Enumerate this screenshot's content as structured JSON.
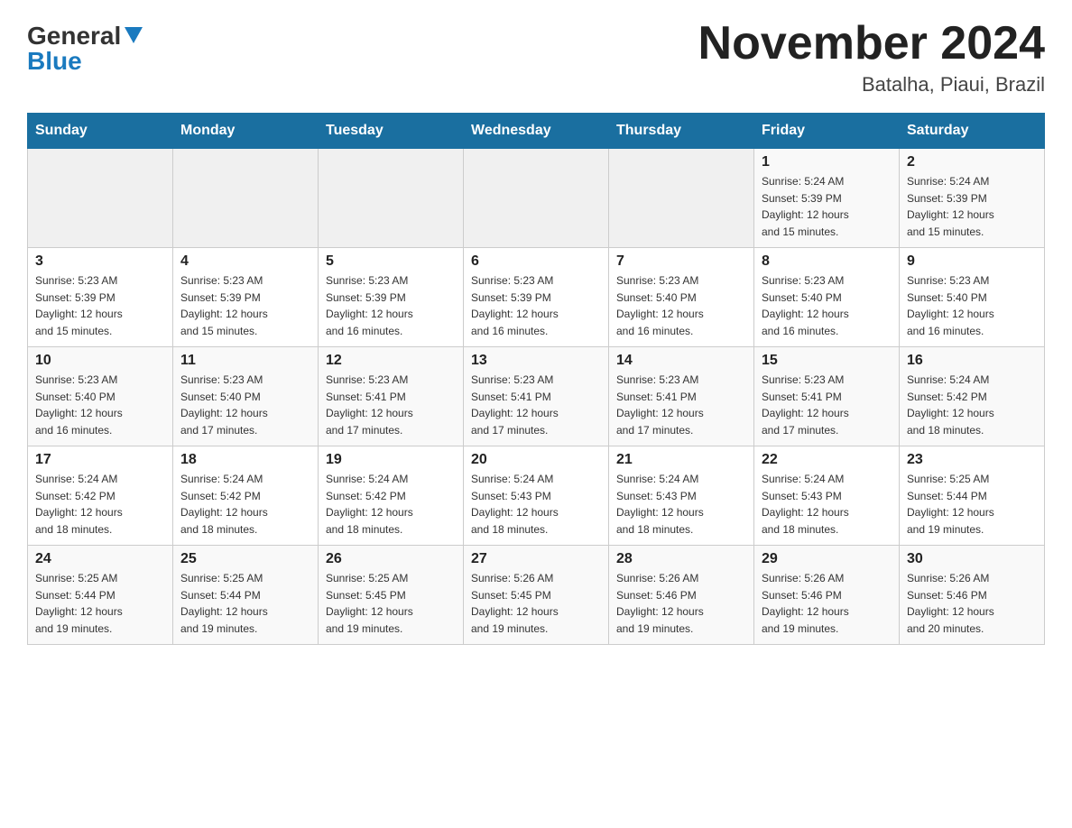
{
  "logo": {
    "general": "General",
    "blue": "Blue"
  },
  "title": "November 2024",
  "location": "Batalha, Piaui, Brazil",
  "days_of_week": [
    "Sunday",
    "Monday",
    "Tuesday",
    "Wednesday",
    "Thursday",
    "Friday",
    "Saturday"
  ],
  "weeks": [
    [
      {
        "day": "",
        "info": ""
      },
      {
        "day": "",
        "info": ""
      },
      {
        "day": "",
        "info": ""
      },
      {
        "day": "",
        "info": ""
      },
      {
        "day": "",
        "info": ""
      },
      {
        "day": "1",
        "info": "Sunrise: 5:24 AM\nSunset: 5:39 PM\nDaylight: 12 hours\nand 15 minutes."
      },
      {
        "day": "2",
        "info": "Sunrise: 5:24 AM\nSunset: 5:39 PM\nDaylight: 12 hours\nand 15 minutes."
      }
    ],
    [
      {
        "day": "3",
        "info": "Sunrise: 5:23 AM\nSunset: 5:39 PM\nDaylight: 12 hours\nand 15 minutes."
      },
      {
        "day": "4",
        "info": "Sunrise: 5:23 AM\nSunset: 5:39 PM\nDaylight: 12 hours\nand 15 minutes."
      },
      {
        "day": "5",
        "info": "Sunrise: 5:23 AM\nSunset: 5:39 PM\nDaylight: 12 hours\nand 16 minutes."
      },
      {
        "day": "6",
        "info": "Sunrise: 5:23 AM\nSunset: 5:39 PM\nDaylight: 12 hours\nand 16 minutes."
      },
      {
        "day": "7",
        "info": "Sunrise: 5:23 AM\nSunset: 5:40 PM\nDaylight: 12 hours\nand 16 minutes."
      },
      {
        "day": "8",
        "info": "Sunrise: 5:23 AM\nSunset: 5:40 PM\nDaylight: 12 hours\nand 16 minutes."
      },
      {
        "day": "9",
        "info": "Sunrise: 5:23 AM\nSunset: 5:40 PM\nDaylight: 12 hours\nand 16 minutes."
      }
    ],
    [
      {
        "day": "10",
        "info": "Sunrise: 5:23 AM\nSunset: 5:40 PM\nDaylight: 12 hours\nand 16 minutes."
      },
      {
        "day": "11",
        "info": "Sunrise: 5:23 AM\nSunset: 5:40 PM\nDaylight: 12 hours\nand 17 minutes."
      },
      {
        "day": "12",
        "info": "Sunrise: 5:23 AM\nSunset: 5:41 PM\nDaylight: 12 hours\nand 17 minutes."
      },
      {
        "day": "13",
        "info": "Sunrise: 5:23 AM\nSunset: 5:41 PM\nDaylight: 12 hours\nand 17 minutes."
      },
      {
        "day": "14",
        "info": "Sunrise: 5:23 AM\nSunset: 5:41 PM\nDaylight: 12 hours\nand 17 minutes."
      },
      {
        "day": "15",
        "info": "Sunrise: 5:23 AM\nSunset: 5:41 PM\nDaylight: 12 hours\nand 17 minutes."
      },
      {
        "day": "16",
        "info": "Sunrise: 5:24 AM\nSunset: 5:42 PM\nDaylight: 12 hours\nand 18 minutes."
      }
    ],
    [
      {
        "day": "17",
        "info": "Sunrise: 5:24 AM\nSunset: 5:42 PM\nDaylight: 12 hours\nand 18 minutes."
      },
      {
        "day": "18",
        "info": "Sunrise: 5:24 AM\nSunset: 5:42 PM\nDaylight: 12 hours\nand 18 minutes."
      },
      {
        "day": "19",
        "info": "Sunrise: 5:24 AM\nSunset: 5:42 PM\nDaylight: 12 hours\nand 18 minutes."
      },
      {
        "day": "20",
        "info": "Sunrise: 5:24 AM\nSunset: 5:43 PM\nDaylight: 12 hours\nand 18 minutes."
      },
      {
        "day": "21",
        "info": "Sunrise: 5:24 AM\nSunset: 5:43 PM\nDaylight: 12 hours\nand 18 minutes."
      },
      {
        "day": "22",
        "info": "Sunrise: 5:24 AM\nSunset: 5:43 PM\nDaylight: 12 hours\nand 18 minutes."
      },
      {
        "day": "23",
        "info": "Sunrise: 5:25 AM\nSunset: 5:44 PM\nDaylight: 12 hours\nand 19 minutes."
      }
    ],
    [
      {
        "day": "24",
        "info": "Sunrise: 5:25 AM\nSunset: 5:44 PM\nDaylight: 12 hours\nand 19 minutes."
      },
      {
        "day": "25",
        "info": "Sunrise: 5:25 AM\nSunset: 5:44 PM\nDaylight: 12 hours\nand 19 minutes."
      },
      {
        "day": "26",
        "info": "Sunrise: 5:25 AM\nSunset: 5:45 PM\nDaylight: 12 hours\nand 19 minutes."
      },
      {
        "day": "27",
        "info": "Sunrise: 5:26 AM\nSunset: 5:45 PM\nDaylight: 12 hours\nand 19 minutes."
      },
      {
        "day": "28",
        "info": "Sunrise: 5:26 AM\nSunset: 5:46 PM\nDaylight: 12 hours\nand 19 minutes."
      },
      {
        "day": "29",
        "info": "Sunrise: 5:26 AM\nSunset: 5:46 PM\nDaylight: 12 hours\nand 19 minutes."
      },
      {
        "day": "30",
        "info": "Sunrise: 5:26 AM\nSunset: 5:46 PM\nDaylight: 12 hours\nand 20 minutes."
      }
    ]
  ]
}
